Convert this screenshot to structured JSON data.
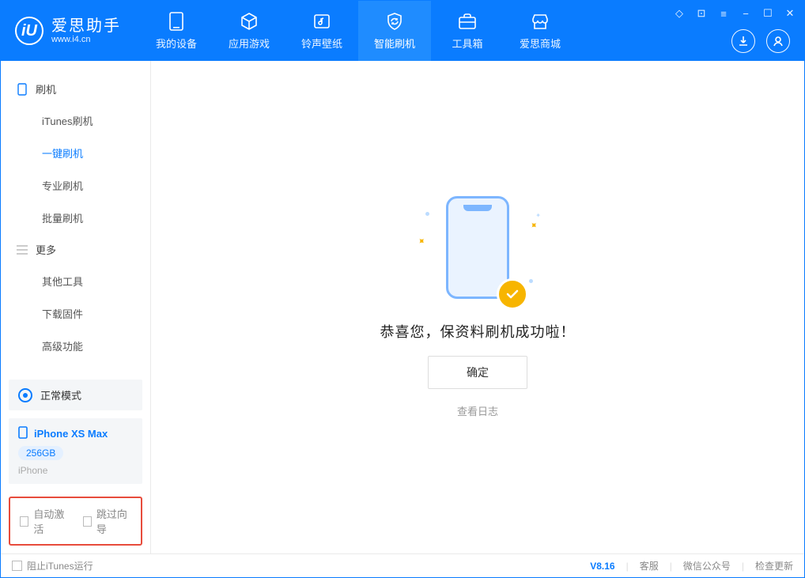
{
  "app": {
    "name": "爱思助手",
    "site": "www.i4.cn"
  },
  "tabs": [
    {
      "id": "device",
      "label": "我的设备"
    },
    {
      "id": "apps",
      "label": "应用游戏"
    },
    {
      "id": "ring",
      "label": "铃声壁纸"
    },
    {
      "id": "flash",
      "label": "智能刷机"
    },
    {
      "id": "tools",
      "label": "工具箱"
    },
    {
      "id": "store",
      "label": "爱思商城"
    }
  ],
  "sidebar": {
    "section1_title": "刷机",
    "section1_items": [
      {
        "label": "iTunes刷机"
      },
      {
        "label": "一键刷机"
      },
      {
        "label": "专业刷机"
      },
      {
        "label": "批量刷机"
      }
    ],
    "section2_title": "更多",
    "section2_items": [
      {
        "label": "其他工具"
      },
      {
        "label": "下载固件"
      },
      {
        "label": "高级功能"
      }
    ]
  },
  "device": {
    "mode": "正常模式",
    "name": "iPhone XS Max",
    "storage": "256GB",
    "type": "iPhone"
  },
  "options": {
    "auto_activate": "自动激活",
    "skip_wizard": "跳过向导"
  },
  "main": {
    "success_text": "恭喜您，保资料刷机成功啦！",
    "ok_button": "确定",
    "log_link": "查看日志"
  },
  "status": {
    "block_itunes": "阻止iTunes运行",
    "version": "V8.16",
    "support": "客服",
    "wechat": "微信公众号",
    "update": "检查更新"
  }
}
